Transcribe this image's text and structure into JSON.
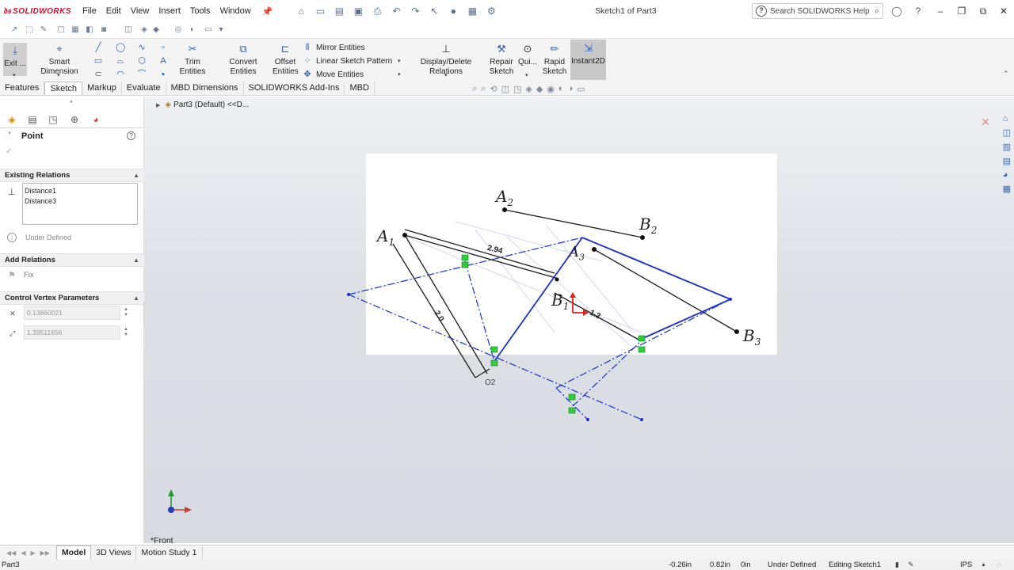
{
  "app": {
    "name": "SOLIDWORKS",
    "document_title": "Sketch1 of Part3"
  },
  "menu": [
    "File",
    "Edit",
    "View",
    "Insert",
    "Tools",
    "Window"
  ],
  "search": {
    "placeholder": "Search SOLIDWORKS Help"
  },
  "commands": {
    "exit_sketch": "Exit ...",
    "smart_dimension": "Smart Dimension",
    "trim_entities": "Trim Entities",
    "convert_entities": "Convert Entities",
    "offset_entities_1": "Offset",
    "offset_entities_2": "Entities",
    "mirror_entities": "Mirror Entities",
    "linear_sketch_pattern": "Linear Sketch Pattern",
    "move_entities": "Move Entities",
    "display_delete_relations": "Display/Delete Relations",
    "repair_sketch_1": "Repair",
    "repair_sketch_2": "Sketch",
    "quick_snaps": "Qui...",
    "rapid_sketch_1": "Rapid",
    "rapid_sketch_2": "Sketch",
    "instant2d": "Instant2D"
  },
  "tabs": [
    "Features",
    "Sketch",
    "Markup",
    "Evaluate",
    "MBD Dimensions",
    "SOLIDWORKS Add-Ins",
    "MBD"
  ],
  "active_tab": "Sketch",
  "tree_flyout": "Part3 (Default) <<D...",
  "property_manager": {
    "title": "Point",
    "existing_relations": {
      "header": "Existing Relations",
      "items": [
        "Distance1",
        "Distance3"
      ],
      "status": "Under Defined"
    },
    "add_relations": {
      "header": "Add Relations",
      "fix_label": "Fix"
    },
    "control_vertex": {
      "header": "Control Vertex Parameters",
      "x_value": "0.13860021",
      "y_value": "1.39511656"
    }
  },
  "sketch_labels": {
    "a1": "A",
    "a1_sub": "1",
    "a2": "A",
    "a2_sub": "2",
    "a3": "A",
    "a3_sub": "3",
    "b1": "B",
    "b1_sub": "1",
    "b2": "B",
    "b2_sub": "2",
    "b3": "B",
    "b3_sub": "3",
    "dim1": "2.94",
    "dim2": "2.0",
    "dim3": "1.2",
    "o2": "O2"
  },
  "view_label": "*Front",
  "bottom_tabs": [
    "Model",
    "3D Views",
    "Motion Study 1"
  ],
  "status_bar": {
    "part": "Part3",
    "x": "-0.26in",
    "y": "0.82in",
    "z": "0in",
    "definition": "Under Defined",
    "mode": "Editing Sketch1",
    "units": "IPS"
  },
  "colors": {
    "accent_blue": "#1a2fcc",
    "brand_red": "#c8102e",
    "active_tool": "#c8c8c8"
  }
}
